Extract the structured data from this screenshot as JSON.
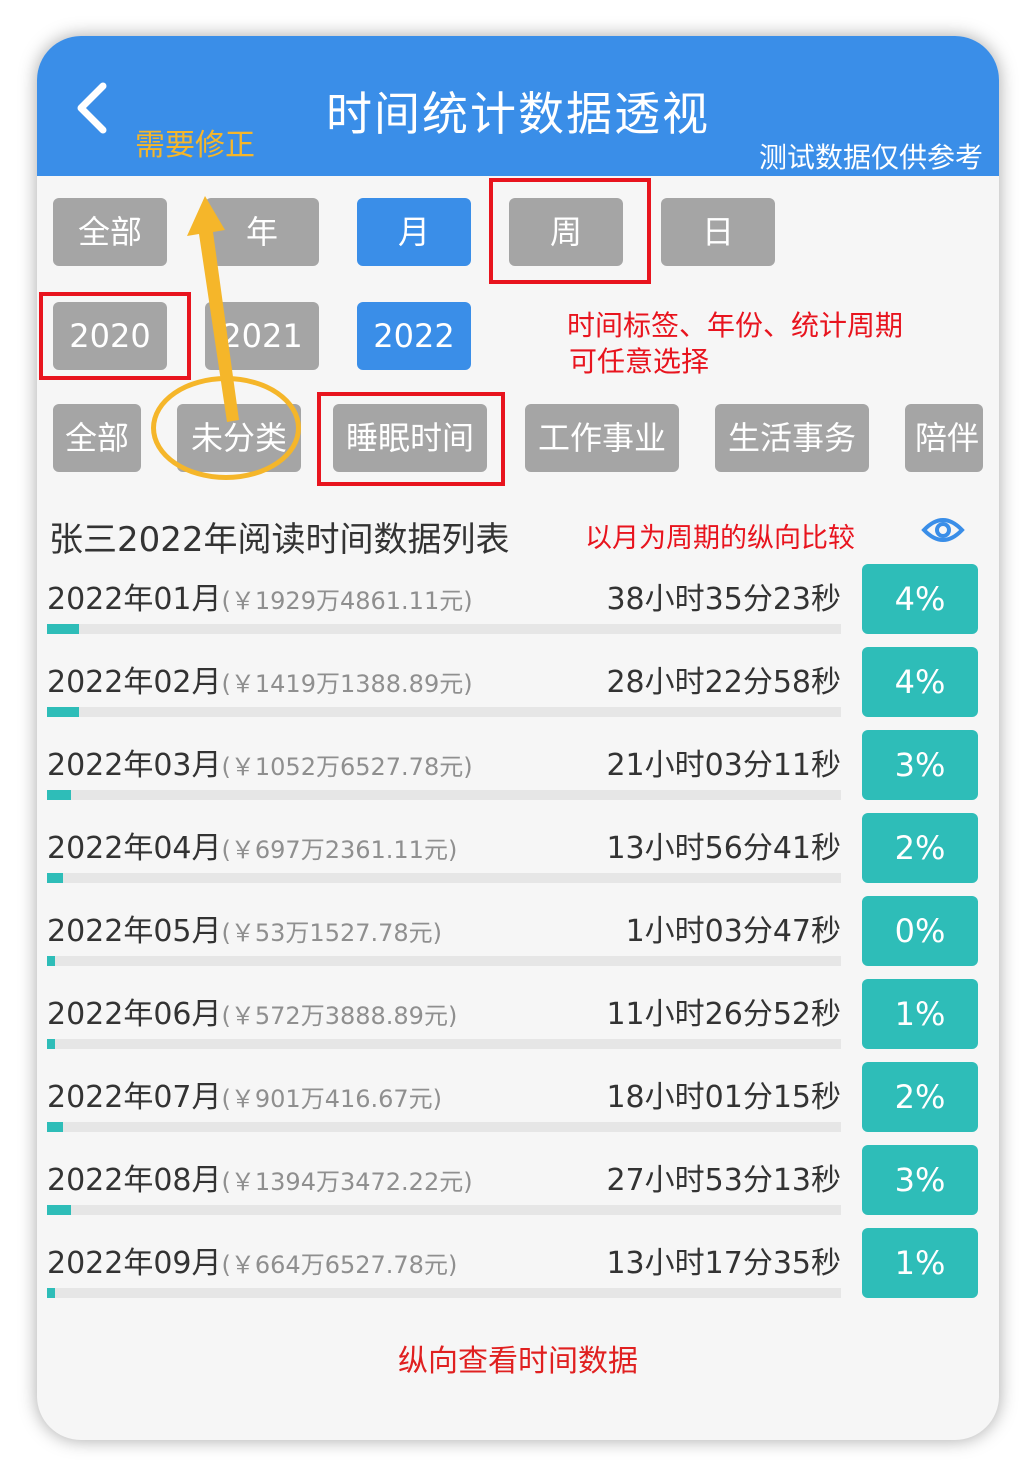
{
  "header": {
    "title": "时间统计数据透视",
    "subtitle": "测试数据仅供参考"
  },
  "period_tabs": [
    "全部",
    "年",
    "月",
    "周",
    "日"
  ],
  "period_active": "月",
  "years": [
    "2020",
    "2021",
    "2022"
  ],
  "year_active": "2022",
  "categories": [
    "全部",
    "未分类",
    "睡眠时间",
    "工作事业",
    "生活事务",
    "陪伴"
  ],
  "section_title": "张三2022年阅读时间数据列表",
  "rows": [
    {
      "period": "2022年01月",
      "amount": "(￥1929万4861.11元)",
      "duration": "38小时35分23秒",
      "percent": "4%",
      "fill": 4
    },
    {
      "period": "2022年02月",
      "amount": "(￥1419万1388.89元)",
      "duration": "28小时22分58秒",
      "percent": "4%",
      "fill": 4
    },
    {
      "period": "2022年03月",
      "amount": "(￥1052万6527.78元)",
      "duration": "21小时03分11秒",
      "percent": "3%",
      "fill": 3
    },
    {
      "period": "2022年04月",
      "amount": "(￥697万2361.11元)",
      "duration": "13小时56分41秒",
      "percent": "2%",
      "fill": 2
    },
    {
      "period": "2022年05月",
      "amount": "(￥53万1527.78元)",
      "duration": "1小时03分47秒",
      "percent": "0%",
      "fill": 0
    },
    {
      "period": "2022年06月",
      "amount": "(￥572万3888.89元)",
      "duration": "11小时26分52秒",
      "percent": "1%",
      "fill": 1
    },
    {
      "period": "2022年07月",
      "amount": "(￥901万416.67元)",
      "duration": "18小时01分15秒",
      "percent": "2%",
      "fill": 2
    },
    {
      "period": "2022年08月",
      "amount": "(￥1394万3472.22元)",
      "duration": "27小时53分13秒",
      "percent": "3%",
      "fill": 3
    },
    {
      "period": "2022年09月",
      "amount": "(￥664万6527.78元)",
      "duration": "13小时17分35秒",
      "percent": "1%",
      "fill": 1
    }
  ],
  "footer_note": "纵向查看时间数据",
  "annotations": {
    "fix_note": "需要修正",
    "selection_note_line1": "时间标签、年份、统计周期",
    "selection_note_line2": "可任意选择",
    "compare_note": "以月为周期的纵向比较"
  },
  "colors": {
    "primary_blue": "#3a8ee8",
    "teal": "#2ebdb8",
    "button_gray": "#a5a5a5",
    "annotation_red": "#e8141e",
    "annotation_yellow": "#f5b62a"
  },
  "icons": [
    "back-arrow-icon",
    "eye-icon"
  ]
}
